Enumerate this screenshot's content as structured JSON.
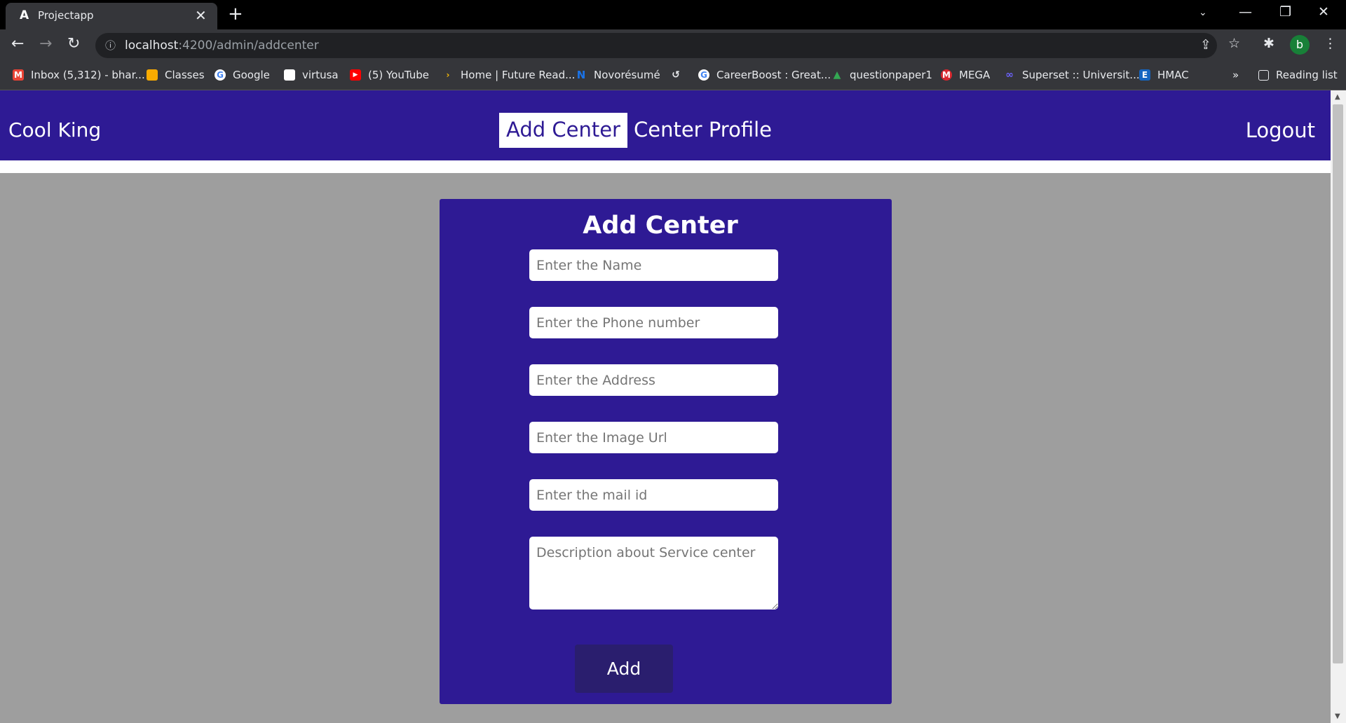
{
  "browser": {
    "tab": {
      "title": "Projectapp",
      "favicon": "angular-icon"
    },
    "url": {
      "host": "localhost",
      "path": ":4200/admin/addcenter"
    },
    "profile_initial": "b",
    "bookmarks": [
      {
        "label": "Inbox (5,312) - bhar...",
        "icon": "gmail-icon",
        "color": "#ea4335"
      },
      {
        "label": "Classes",
        "icon": "classroom-icon",
        "color": "#f9ab00"
      },
      {
        "label": "Google",
        "icon": "google-icon",
        "color": "#4285f4"
      },
      {
        "label": "virtusa",
        "icon": "virtusa-icon",
        "color": "#ffffff"
      },
      {
        "label": "(5) YouTube",
        "icon": "youtube-icon",
        "color": "#ff0000"
      },
      {
        "label": "Home | Future Read...",
        "icon": "future-ready-icon",
        "color": "#fbbc04"
      },
      {
        "label": "Novorésumé",
        "icon": "novoresume-icon",
        "color": "#1a73e8"
      },
      {
        "label": "CareerBoost : Great...",
        "icon": "careerboost-icon",
        "color": "#ffffff"
      },
      {
        "label": "questionpaper1",
        "icon": "drive-icon",
        "color": "#34a853"
      },
      {
        "label": "MEGA",
        "icon": "mega-icon",
        "color": "#d9272e"
      },
      {
        "label": "Superset :: Universit...",
        "icon": "superset-icon",
        "color": "#6c63ff"
      },
      {
        "label": "HMAC",
        "icon": "hmac-icon",
        "color": "#1565c0"
      }
    ],
    "bookmarks_more": "»",
    "reading_list": "Reading list"
  },
  "nav": {
    "brand": "Cool King",
    "links": [
      {
        "label": "Add Center",
        "active": true
      },
      {
        "label": "Center Profile",
        "active": false
      }
    ],
    "logout": "Logout"
  },
  "form": {
    "title": "Add Center",
    "fields": {
      "name": {
        "placeholder": "Enter the Name"
      },
      "phone": {
        "placeholder": "Enter the Phone number"
      },
      "address": {
        "placeholder": "Enter the Address"
      },
      "image_url": {
        "placeholder": "Enter the Image Url"
      },
      "mail": {
        "placeholder": "Enter the mail id"
      },
      "description": {
        "placeholder": "Description about Service center"
      }
    },
    "submit_label": "Add"
  },
  "colors": {
    "nav_bg": "#2e1a94",
    "card_bg": "#2e1a94",
    "page_bg": "#9e9e9e",
    "button_bg": "#2a1e6e"
  }
}
